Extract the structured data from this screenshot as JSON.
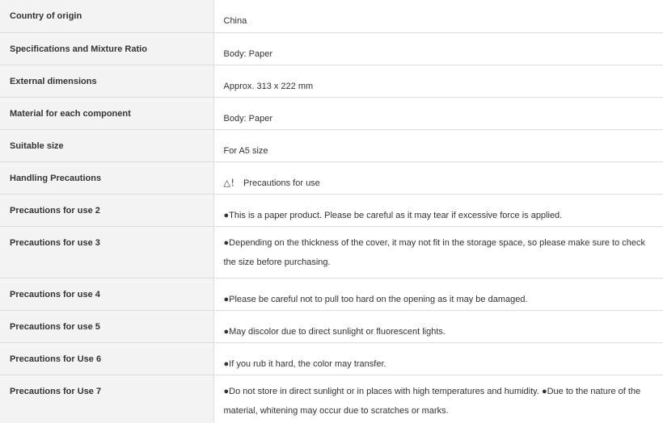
{
  "rows": [
    {
      "label": "Country of origin",
      "value": "China"
    },
    {
      "label": "Specifications and Mixture Ratio",
      "value": "Body: Paper"
    },
    {
      "label": "External dimensions",
      "value": "Approx. 313 x 222 mm"
    },
    {
      "label": "Material for each component",
      "value": "Body: Paper"
    },
    {
      "label": "Suitable size",
      "value": "For A5 size"
    },
    {
      "label": "Handling Precautions",
      "icon": "warning-triangle-icon",
      "icon_glyph": "△！",
      "value": "Precautions for use"
    },
    {
      "label": "Precautions for use 2",
      "value": "●This is a paper product. Please be careful as it may tear if excessive force is applied."
    },
    {
      "label": "Precautions for use 3",
      "value": "●Depending on the thickness of the cover, it may not fit in the storage space, so please make sure to check the size before purchasing."
    },
    {
      "label": "Precautions for use 4",
      "value": "●Please be careful not to pull too hard on the opening as it may be damaged."
    },
    {
      "label": "Precautions for use 5",
      "value": "●May discolor due to direct sunlight or fluorescent lights."
    },
    {
      "label": "Precautions for Use 6",
      "value": "●If you rub it hard, the color may transfer."
    },
    {
      "label": "Precautions for Use 7",
      "value": "●Do not store in direct sunlight or in places with high temperatures and humidity. ●Due to the nature of the material, whitening may occur due to scratches or marks."
    }
  ]
}
